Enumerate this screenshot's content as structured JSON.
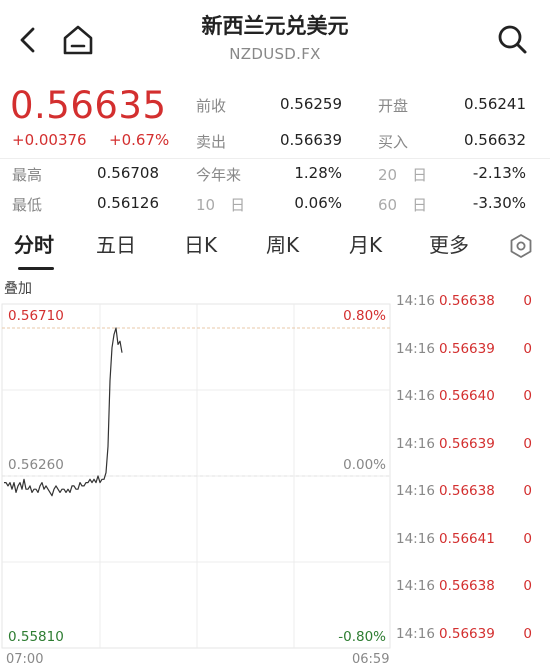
{
  "header": {
    "title": "新西兰元兑美元",
    "symbol": "NZDUSD.FX"
  },
  "quote": {
    "price": "0.56635",
    "change": "+0.00376",
    "change_pct": "+0.67%",
    "prev_close_label": "前收",
    "prev_close": "0.56259",
    "open_label": "开盘",
    "open": "0.56241",
    "ask_label": "卖出",
    "ask": "0.56639",
    "bid_label": "买入",
    "bid": "0.56632",
    "high_label": "最高",
    "high": "0.56708",
    "ytd_label": "今年来",
    "ytd": "1.28%",
    "d20_label": "20　日",
    "d20": "-2.13%",
    "low_label": "最低",
    "low": "0.56126",
    "d10_label": "10　日",
    "d10": "0.06%",
    "d60_label": "60　日",
    "d60": "-3.30%"
  },
  "tabs": [
    "分时",
    "五日",
    "日K",
    "周K",
    "月K",
    "更多"
  ],
  "active_tab": "分时",
  "overlay_label": "叠加",
  "chart_data": {
    "type": "line",
    "price_labels": {
      "top": "0.56710",
      "mid": "0.56260",
      "bottom": "0.55810"
    },
    "pct_labels": {
      "top": "0.80%",
      "mid": "0.00%",
      "bottom": "-0.80%"
    },
    "x_labels": {
      "start": "07:00",
      "end": "06:59"
    },
    "ylim": [
      0.5581,
      0.5671
    ],
    "reference": 0.5626,
    "series": [
      {
        "values": [
          0.5624,
          0.5624,
          0.5623,
          0.5624,
          0.5622,
          0.5624,
          0.5621,
          0.5623,
          0.5624,
          0.5622,
          0.5625,
          0.5622,
          0.5622,
          0.5623,
          0.5621,
          0.5622,
          0.5622,
          0.5621,
          0.5623,
          0.5624,
          0.5622,
          0.5623,
          0.5622,
          0.5621,
          0.562,
          0.5622,
          0.5623,
          0.5622,
          0.5621,
          0.5622,
          0.5622,
          0.5621,
          0.5622,
          0.5621,
          0.5623,
          0.5623,
          0.5622,
          0.5622,
          0.5624,
          0.5623,
          0.5623,
          0.5624,
          0.5624,
          0.5625,
          0.5624,
          0.5625,
          0.5624,
          0.5626,
          0.5624,
          0.5625,
          0.5625,
          0.5627,
          0.5635,
          0.5655,
          0.5665,
          0.5669,
          0.5671,
          0.5666,
          0.5667,
          0.56635
        ]
      }
    ]
  },
  "trades": [
    {
      "time": "14:16",
      "price": "0.56638",
      "vol": "0"
    },
    {
      "time": "14:16",
      "price": "0.56639",
      "vol": "0"
    },
    {
      "time": "14:16",
      "price": "0.56640",
      "vol": "0"
    },
    {
      "time": "14:16",
      "price": "0.56639",
      "vol": "0"
    },
    {
      "time": "14:16",
      "price": "0.56638",
      "vol": "0"
    },
    {
      "time": "14:16",
      "price": "0.56641",
      "vol": "0"
    },
    {
      "time": "14:16",
      "price": "0.56638",
      "vol": "0"
    },
    {
      "time": "14:16",
      "price": "0.56639",
      "vol": "0"
    }
  ],
  "colors": {
    "up": "#d32f2f",
    "down": "#2e7d32",
    "line": "#333333",
    "grid": "#e6e6e6"
  }
}
